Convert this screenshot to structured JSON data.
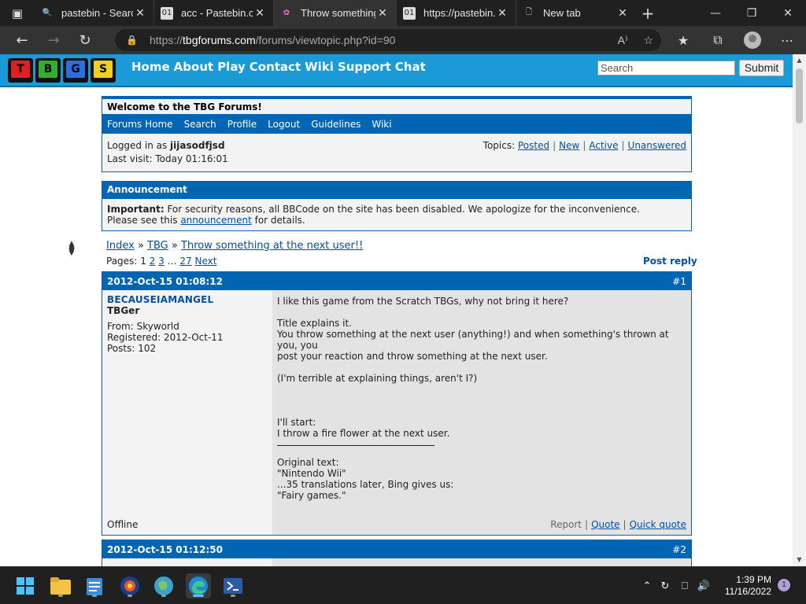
{
  "browser": {
    "tabs": [
      {
        "title": "pastebin - Search",
        "icon": "search-icon",
        "active": false
      },
      {
        "title": "acc - Pastebin.com",
        "icon": "pastebin-icon",
        "active": false
      },
      {
        "title": "Throw something at the next user!!",
        "icon": "tbg-icon",
        "active": true
      },
      {
        "title": "https://pastebin.com",
        "icon": "pastebin-icon",
        "active": false
      },
      {
        "title": "New tab",
        "icon": "page-icon",
        "active": false
      }
    ],
    "url_prefix": "https://",
    "url_domain": "tbgforums.com",
    "url_path": "/forums/viewtopic.php?id=90"
  },
  "site": {
    "logo_letters": [
      "T",
      "B",
      "G",
      "S"
    ],
    "logo_colors": [
      "#e02020",
      "#2fb02f",
      "#2a6fe0",
      "#f0d020"
    ],
    "nav": [
      "Home",
      "About",
      "Play",
      "Contact",
      "Wiki",
      "Support",
      "Chat"
    ],
    "search_placeholder": "Search",
    "submit_label": "Submit"
  },
  "welcome": {
    "title": "Welcome to the TBG Forums!",
    "menu": [
      "Forums Home",
      "Search",
      "Profile",
      "Logout",
      "Guidelines",
      "Wiki"
    ],
    "logged_in_prefix": "Logged in as ",
    "username": "jijasodfjsd",
    "last_visit": "Last visit: Today 01:16:01",
    "topics_label": "Topics:",
    "topics_links": [
      "Posted",
      "New",
      "Active",
      "Unanswered"
    ]
  },
  "announcement": {
    "title": "Announcement",
    "important_label": "Important:",
    "text1": " For security reasons, all BBCode on the site has been disabled. We apologize for the inconvenience.",
    "text2_before": "Please see this ",
    "link": "announcement",
    "text2_after": " for details."
  },
  "breadcrumb": {
    "items": [
      "Index",
      "TBG",
      "Throw something at the next user!!"
    ],
    "separator": "»"
  },
  "pagination": {
    "label": "Pages:",
    "current": "1",
    "pages": [
      "2",
      "3"
    ],
    "ellipsis": "…",
    "last": "27",
    "next": "Next",
    "post_reply": "Post reply"
  },
  "posts": [
    {
      "date": "2012-Oct-15  01:08:12",
      "number": "#1",
      "author": "BECAUSEIAMANGEL",
      "rank": "TBGer",
      "from": "From: Skyworld",
      "registered": "Registered: 2012-Oct-11",
      "posts": "Posts: 102",
      "status": "Offline",
      "body": {
        "l1": "I like this game from the Scratch TBGs, why not bring it here?",
        "l2": "Title explains it.",
        "l3": "You throw something at the next user (anything!) and when something's thrown at you, you",
        "l4": "post your reaction and throw something at the next user.",
        "l5": "(I'm terrible at explaining things, aren't I?)",
        "l6": "I'll start:",
        "l7": "I throw a fire flower at the next user.",
        "l8": "Original text:",
        "l9": "\"Nintendo Wii\"",
        "l10": "...35 translations later, Bing gives us:",
        "l11": "\"Fairy games.\""
      },
      "actions": [
        "Report",
        "Quote",
        "Quick quote"
      ]
    },
    {
      "date": "2012-Oct-15  01:12:50",
      "number": "#2"
    }
  ],
  "taskbar": {
    "time": "1:39 PM",
    "date": "11/16/2022",
    "notifications": "1"
  }
}
